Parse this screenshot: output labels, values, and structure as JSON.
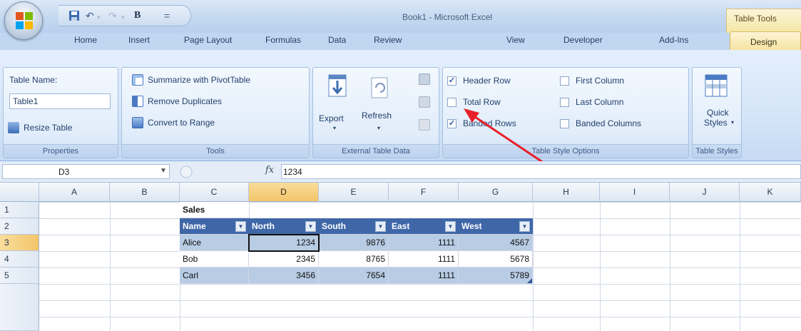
{
  "window": {
    "title": "Book1 - Microsoft Excel",
    "context_tab_title": "Table Tools"
  },
  "quick_access": {
    "save_icon": "save-icon",
    "undo_icon": "undo-icon",
    "redo_icon": "redo-icon",
    "bold_label": "B",
    "customize_label": "="
  },
  "tabs": [
    {
      "label": "Home"
    },
    {
      "label": "Insert"
    },
    {
      "label": "Page Layout"
    },
    {
      "label": "Formulas"
    },
    {
      "label": "Data"
    },
    {
      "label": "Review"
    },
    {
      "label": "View"
    },
    {
      "label": "Developer"
    },
    {
      "label": "Add-Ins"
    },
    {
      "label": "Design"
    }
  ],
  "ribbon": {
    "properties": {
      "label": "Properties",
      "table_name_caption": "Table Name:",
      "table_name_value": "Table1",
      "resize_label": "Resize Table"
    },
    "tools": {
      "label": "Tools",
      "summarize": "Summarize with PivotTable",
      "remove_duplicates": "Remove Duplicates",
      "convert": "Convert to Range"
    },
    "external": {
      "label": "External Table Data",
      "export": "Export",
      "refresh": "Refresh"
    },
    "style_options": {
      "label": "Table Style Options",
      "header_row": "Header Row",
      "total_row": "Total Row",
      "banded_rows": "Banded Rows",
      "first_column": "First Column",
      "last_column": "Last Column",
      "banded_columns": "Banded Columns",
      "header_row_checked": true,
      "total_row_checked": false,
      "banded_rows_checked": true,
      "first_column_checked": false,
      "last_column_checked": false,
      "banded_columns_checked": false
    },
    "table_styles": {
      "label": "Table Styles",
      "quick_styles_line1": "Quick",
      "quick_styles_line2": "Styles"
    }
  },
  "formula_bar": {
    "cell_ref": "D3",
    "fx": "fx",
    "value": "1234"
  },
  "grid": {
    "columns": [
      "A",
      "B",
      "C",
      "D",
      "E",
      "F",
      "G",
      "H",
      "I",
      "J",
      "K"
    ],
    "rows": [
      "1",
      "2",
      "3",
      "4",
      "5"
    ],
    "title_cell": "Sales",
    "table_headers": [
      "Name",
      "North",
      "South",
      "East",
      "West"
    ],
    "table_rows": [
      [
        "Alice",
        "1234",
        "9876",
        "1111",
        "4567"
      ],
      [
        "Bob",
        "2345",
        "8765",
        "1111",
        "5678"
      ],
      [
        "Carl",
        "3456",
        "7654",
        "1111",
        "5789"
      ]
    ]
  },
  "colors": {
    "table_header": "#3f67a8",
    "band": "#b8cce4",
    "selection_header": "#f3c56a",
    "annotation_arrow": "#e8202a"
  }
}
